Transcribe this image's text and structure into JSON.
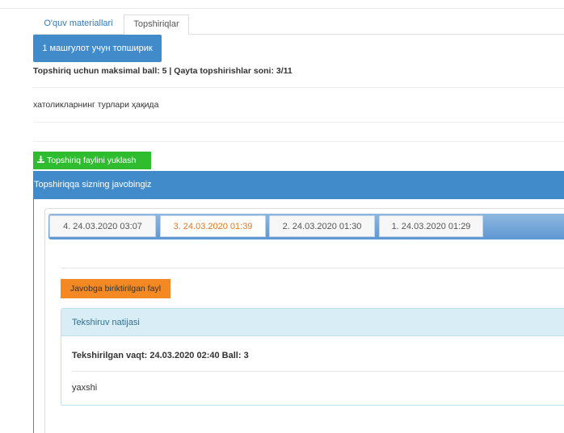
{
  "tabs": {
    "materials_label": "O'quv materiallari",
    "tasks_label": "Topshiriqlar"
  },
  "task": {
    "button_label": "1 машғулот учун топширик",
    "info": "Topshiriq uchun maksimal ball: 5 | Qayta topshirishlar soni: 3/11",
    "topic": "хатоликларнинг турлари ҳақида"
  },
  "upload": {
    "icon": "download-icon",
    "label": "Topshiriq faylini yuklash"
  },
  "answer_panel": {
    "title": "Topshiriqqa sizning javobingiz",
    "versions": [
      {
        "label": "4. 24.03.2020 03:07",
        "active": false
      },
      {
        "label": "3. 24.03.2020 01:39",
        "active": true
      },
      {
        "label": "2. 24.03.2020 01:30",
        "active": false
      },
      {
        "label": "1. 24.03.2020 01:29",
        "active": false
      }
    ],
    "attached_file_label": "Javobga biriktirilgan fayl",
    "result": {
      "title": "Tekshiruv natijasi",
      "checked_line": "Tekshirilgan vaqt: 24.03.2020 02:40 Ball: 3",
      "comment": "yaxshi"
    }
  },
  "colors": {
    "primary": "#428bca",
    "success": "#2fbd2f",
    "warning": "#f48924",
    "active_tab_text": "#e87722",
    "info_bg": "#d9edf7"
  }
}
